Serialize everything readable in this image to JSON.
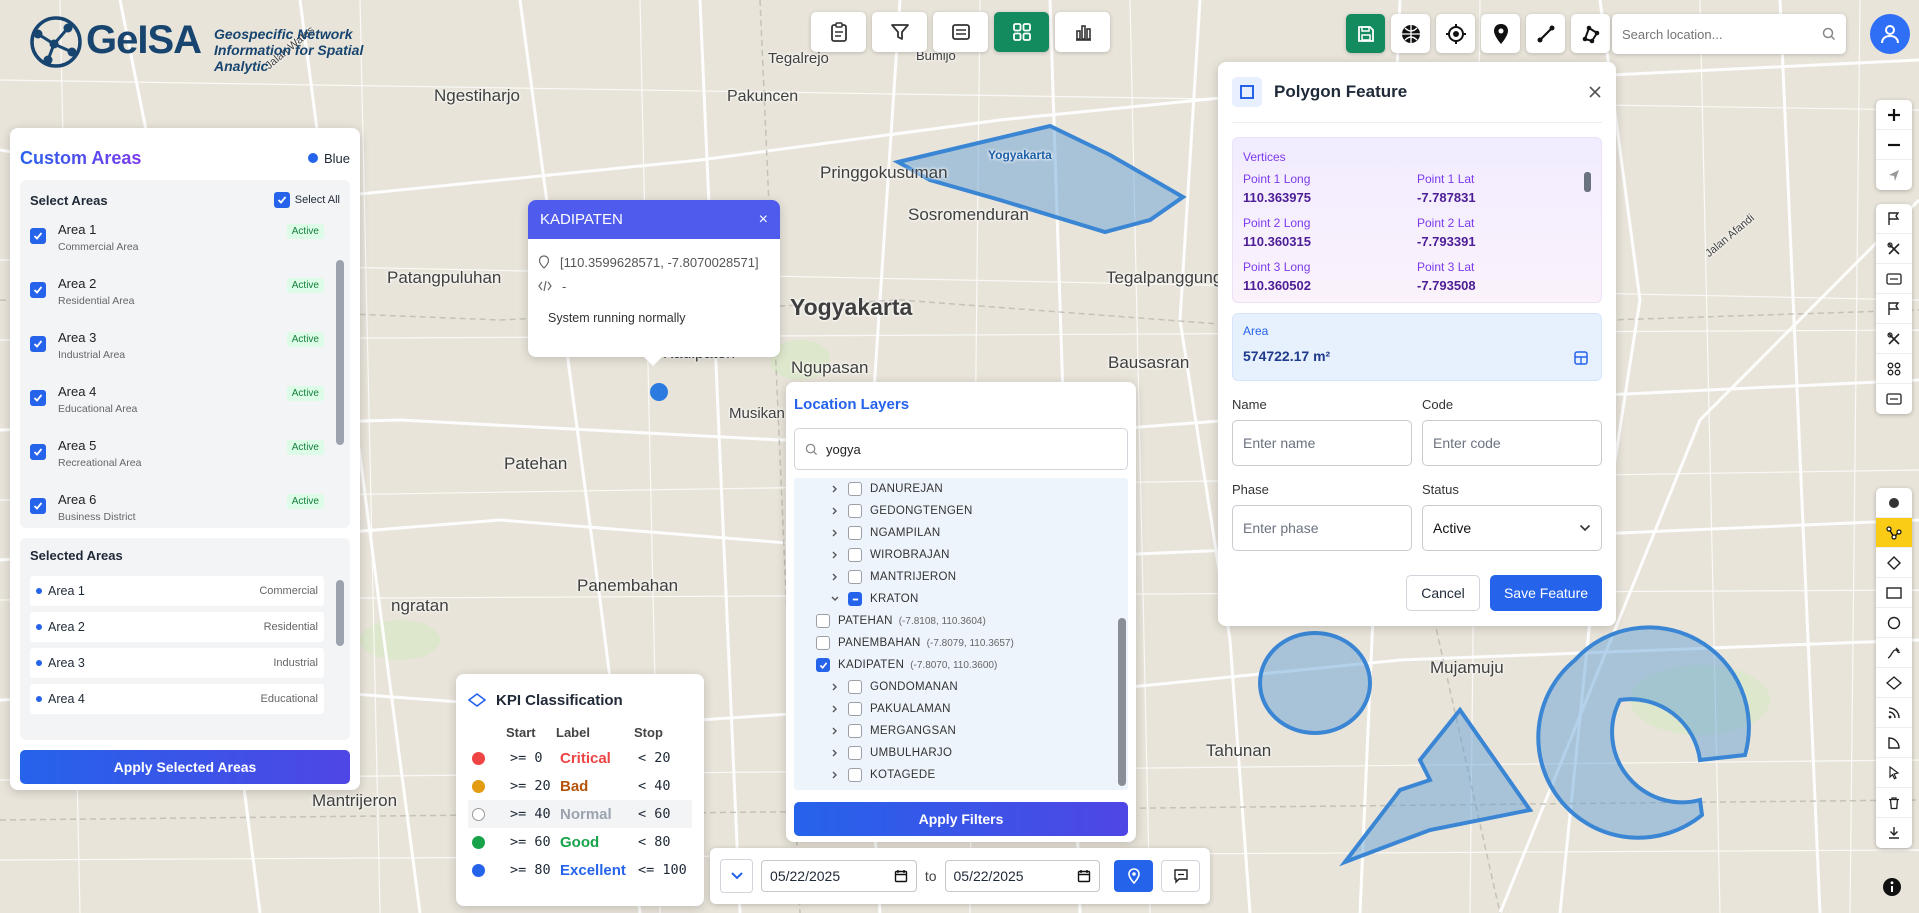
{
  "app": {
    "name": "GeISA",
    "tagline_1": "Geospecific Network",
    "tagline_2": "Information for Spatial Analytic"
  },
  "map_labels": [
    "Tegalrejo",
    "Bumijo",
    "Ngestiharjo",
    "Pakuncen",
    "Pringgokusuman",
    "Sosromenduran",
    "Patangpuluhan",
    "Yogyakarta",
    "Tegalpanggung",
    "Kadipaten",
    "Ngupasan",
    "Bausasran",
    "Musikan",
    "Patehan",
    "Panembahan",
    "ngratan",
    "Mantrijeron",
    "Mujamuju",
    "Tahunan",
    "Jalan Afandi",
    "Jalan Wates",
    "Yogyakarta"
  ],
  "search": {
    "placeholder": "Search location..."
  },
  "custom_areas": {
    "title": "Custom Areas",
    "color_label": "Blue",
    "select_title": "Select Areas",
    "select_all": "Select All",
    "areas": [
      {
        "name": "Area 1",
        "type": "Commercial Area",
        "status": "Active"
      },
      {
        "name": "Area 2",
        "type": "Residential Area",
        "status": "Active"
      },
      {
        "name": "Area 3",
        "type": "Industrial Area",
        "status": "Active"
      },
      {
        "name": "Area 4",
        "type": "Educational Area",
        "status": "Active"
      },
      {
        "name": "Area 5",
        "type": "Recreational Area",
        "status": "Active"
      },
      {
        "name": "Area 6",
        "type": "Business District",
        "status": "Active"
      }
    ],
    "selected_title": "Selected Areas",
    "selected": [
      {
        "name": "Area 1",
        "type": "Commercial"
      },
      {
        "name": "Area 2",
        "type": "Residential"
      },
      {
        "name": "Area 3",
        "type": "Industrial"
      },
      {
        "name": "Area 4",
        "type": "Educational"
      }
    ],
    "apply_label": "Apply Selected Areas"
  },
  "popup": {
    "title": "KADIPATEN",
    "close": "×",
    "coords": "[110.3599628571, -7.8070028571]",
    "code": "-",
    "status": "System running normally"
  },
  "layers": {
    "title": "Location Layers",
    "search_value": "yogya",
    "items": [
      {
        "label": "DANUREJAN",
        "detail": "",
        "level": 0,
        "state": "unchecked",
        "expanded": false
      },
      {
        "label": "GEDONGTENGEN",
        "detail": "",
        "level": 0,
        "state": "unchecked",
        "expanded": false
      },
      {
        "label": "NGAMPILAN",
        "detail": "",
        "level": 0,
        "state": "unchecked",
        "expanded": false
      },
      {
        "label": "WIROBRAJAN",
        "detail": "",
        "level": 0,
        "state": "unchecked",
        "expanded": false
      },
      {
        "label": "MANTRIJERON",
        "detail": "",
        "level": 0,
        "state": "unchecked",
        "expanded": false
      },
      {
        "label": "KRATON",
        "detail": "",
        "level": 0,
        "state": "partial",
        "expanded": true
      },
      {
        "label": "PATEHAN",
        "detail": "(-7.8108, 110.3604)",
        "level": 1,
        "state": "unchecked",
        "expanded": false
      },
      {
        "label": "PANEMBAHAN",
        "detail": "(-7.8079, 110.3657)",
        "level": 1,
        "state": "unchecked",
        "expanded": false
      },
      {
        "label": "KADIPATEN",
        "detail": "(-7.8070, 110.3600)",
        "level": 1,
        "state": "checked",
        "expanded": false
      },
      {
        "label": "GONDOMANAN",
        "detail": "",
        "level": 0,
        "state": "unchecked",
        "expanded": false
      },
      {
        "label": "PAKUALAMAN",
        "detail": "",
        "level": 0,
        "state": "unchecked",
        "expanded": false
      },
      {
        "label": "MERGANGSAN",
        "detail": "",
        "level": 0,
        "state": "unchecked",
        "expanded": false
      },
      {
        "label": "UMBULHARJO",
        "detail": "",
        "level": 0,
        "state": "unchecked",
        "expanded": false
      },
      {
        "label": "KOTAGEDE",
        "detail": "",
        "level": 0,
        "state": "unchecked",
        "expanded": false
      }
    ],
    "apply_label": "Apply Filters"
  },
  "kpi": {
    "title": "KPI Classification",
    "headers": [
      "Start",
      "Label",
      "Stop"
    ],
    "rows": [
      {
        "start": ">= 0",
        "label": "Critical",
        "stop": "< 20",
        "color": "#ef4444"
      },
      {
        "start": ">= 20",
        "label": "Bad",
        "stop": "< 40",
        "color": "#e39b12"
      },
      {
        "start": ">= 40",
        "label": "Normal",
        "stop": "< 60",
        "color": "#ffffff"
      },
      {
        "start": ">= 60",
        "label": "Good",
        "stop": "< 80",
        "color": "#16a34a"
      },
      {
        "start": ">= 80",
        "label": "Excellent",
        "stop": "<= 100",
        "color": "#2563eb"
      }
    ]
  },
  "dates": {
    "from": "05/22/2025",
    "to_label": "to",
    "to": "05/22/2025"
  },
  "polygon": {
    "title": "Polygon Feature",
    "vertices_label": "Vertices",
    "vertices": [
      {
        "long_label": "Point 1 Long",
        "long": "110.363975",
        "lat_label": "Point 1 Lat",
        "lat": "-7.787831"
      },
      {
        "long_label": "Point 2 Long",
        "long": "110.360315",
        "lat_label": "Point 2 Lat",
        "lat": "-7.793391"
      },
      {
        "long_label": "Point 3 Long",
        "long": "110.360502",
        "lat_label": "Point 3 Lat",
        "lat": "-7.793508"
      }
    ],
    "area_label": "Area",
    "area_value": "574722.17 m²",
    "name_label": "Name",
    "name_placeholder": "Enter name",
    "code_label": "Code",
    "code_placeholder": "Enter code",
    "phase_label": "Phase",
    "phase_placeholder": "Enter phase",
    "status_label": "Status",
    "status_value": "Active",
    "cancel_label": "Cancel",
    "save_label": "Save Feature"
  },
  "colors": {
    "accent": "#2563eb",
    "green": "#148a5f",
    "purple": "#4f5bec",
    "polygon_fill": "#5b9bd5"
  }
}
